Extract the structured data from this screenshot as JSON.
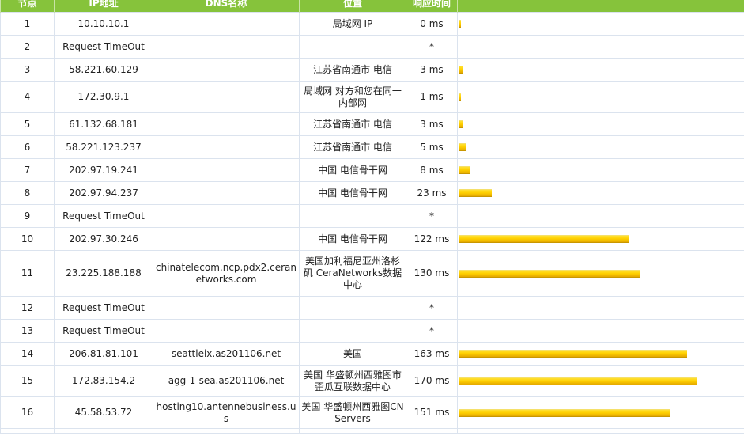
{
  "headers": {
    "hop": "节点",
    "ip": "IP地址",
    "dns": "DNS名称",
    "location": "位置",
    "time": "响应时间"
  },
  "rows": [
    {
      "hop": "1",
      "ip": "10.10.10.1",
      "dns": "",
      "location": "局域网 IP",
      "time": "0 ms",
      "ms": 0
    },
    {
      "hop": "2",
      "ip": "Request TimeOut",
      "dns": "",
      "location": "",
      "time": "*",
      "ms": null
    },
    {
      "hop": "3",
      "ip": "58.221.60.129",
      "dns": "",
      "location": "江苏省南通市 电信",
      "time": "3 ms",
      "ms": 3
    },
    {
      "hop": "4",
      "ip": "172.30.9.1",
      "dns": "",
      "location": "局域网 对方和您在同一内部网",
      "time": "1 ms",
      "ms": 1
    },
    {
      "hop": "5",
      "ip": "61.132.68.181",
      "dns": "",
      "location": "江苏省南通市 电信",
      "time": "3 ms",
      "ms": 3
    },
    {
      "hop": "6",
      "ip": "58.221.123.237",
      "dns": "",
      "location": "江苏省南通市 电信",
      "time": "5 ms",
      "ms": 5
    },
    {
      "hop": "7",
      "ip": "202.97.19.241",
      "dns": "",
      "location": "中国 电信骨干网",
      "time": "8 ms",
      "ms": 8
    },
    {
      "hop": "8",
      "ip": "202.97.94.237",
      "dns": "",
      "location": "中国 电信骨干网",
      "time": "23 ms",
      "ms": 23
    },
    {
      "hop": "9",
      "ip": "Request TimeOut",
      "dns": "",
      "location": "",
      "time": "*",
      "ms": null
    },
    {
      "hop": "10",
      "ip": "202.97.30.246",
      "dns": "",
      "location": "中国 电信骨干网",
      "time": "122 ms",
      "ms": 122
    },
    {
      "hop": "11",
      "ip": "23.225.188.188",
      "dns": "chinatelecom.ncp.pdx2.ceranetworks.com",
      "location": "美国加利福尼亚州洛杉矶 CeraNetworks数据中心",
      "time": "130 ms",
      "ms": 130
    },
    {
      "hop": "12",
      "ip": "Request TimeOut",
      "dns": "",
      "location": "",
      "time": "*",
      "ms": null
    },
    {
      "hop": "13",
      "ip": "Request TimeOut",
      "dns": "",
      "location": "",
      "time": "*",
      "ms": null
    },
    {
      "hop": "14",
      "ip": "206.81.81.101",
      "dns": "seattleix.as201106.net",
      "location": "美国",
      "time": "163 ms",
      "ms": 163
    },
    {
      "hop": "15",
      "ip": "172.83.154.2",
      "dns": "agg-1-sea.as201106.net",
      "location": "美国 华盛顿州西雅图市 歪瓜互联数据中心",
      "time": "170 ms",
      "ms": 170
    },
    {
      "hop": "16",
      "ip": "45.58.53.72",
      "dns": "hosting10.antennebusiness.us",
      "location": "美国 华盛顿州西雅图CN Servers",
      "time": "151 ms",
      "ms": 151
    }
  ],
  "colors": {
    "header_bg": "#86c33b",
    "bar": "#ffd000",
    "border": "#dbe3ee"
  }
}
